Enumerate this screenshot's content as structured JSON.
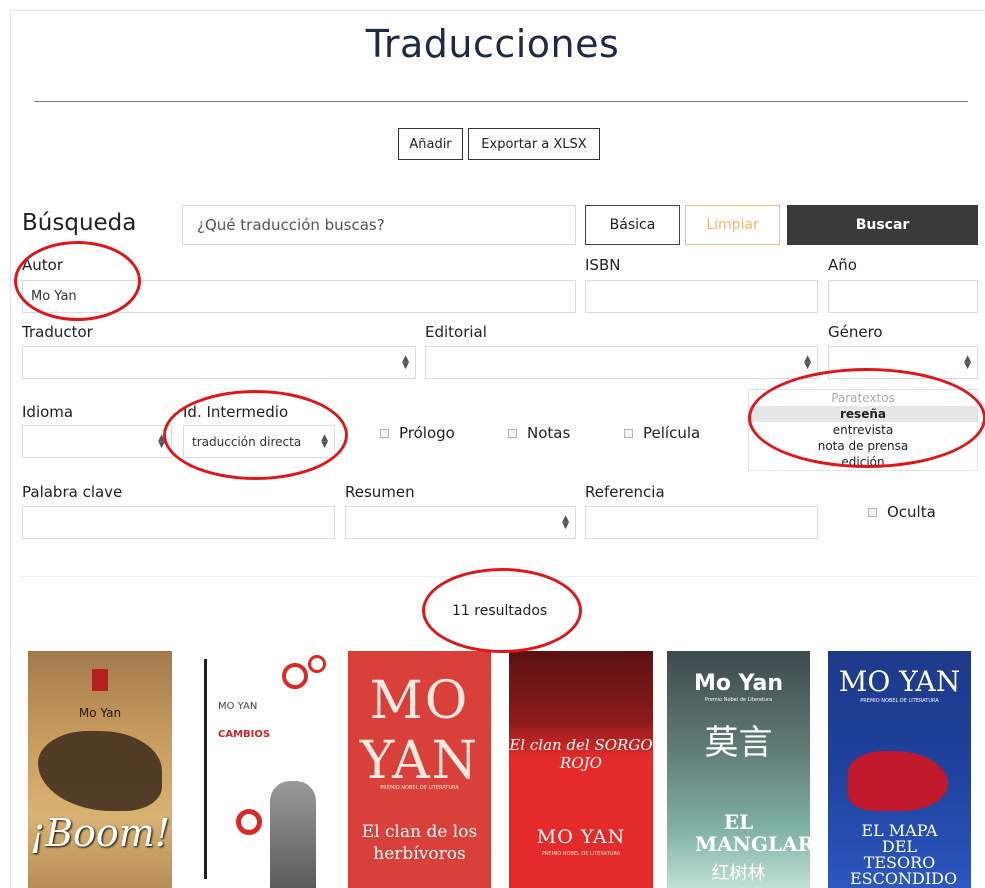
{
  "header": {
    "title": "Traducciones"
  },
  "toolbar": {
    "add_label": "Añadir",
    "export_label": "Exportar a XLSX"
  },
  "search": {
    "heading": "Búsqueda",
    "placeholder": "¿Qué traducción buscas?",
    "basic_label": "Básica",
    "clear_label": "Limpiar",
    "search_label": "Buscar"
  },
  "filters": {
    "autor_label": "Autor",
    "autor_value": "Mo Yan",
    "isbn_label": "ISBN",
    "anio_label": "Año",
    "traductor_label": "Traductor",
    "editorial_label": "Editorial",
    "genero_label": "Género",
    "idioma_label": "Idioma",
    "intermedio_label": "Id. Intermedio",
    "intermedio_value": "traducción directa",
    "prologo_label": "Prólogo",
    "notas_label": "Notas",
    "pelicula_label": "Película",
    "paratextos": {
      "placeholder": "Paratextos",
      "options": [
        "reseña",
        "entrevista",
        "nota de prensa",
        "edición"
      ],
      "selected": "reseña"
    },
    "palabra_label": "Palabra clave",
    "resumen_label": "Resumen",
    "referencia_label": "Referencia",
    "oculta_label": "Oculta"
  },
  "results": {
    "count_text": "11 resultados",
    "covers": [
      {
        "author": "Mo Yan",
        "title": "¡Boom!"
      },
      {
        "author": "MO YAN",
        "title": "CAMBIOS"
      },
      {
        "author": "MO YAN",
        "title": "El clan de los herbívoros",
        "subtitle": "PREMIO NOBEL DE LITERATURA"
      },
      {
        "author": "MO YAN",
        "title": "El clan del SORGO ROJO",
        "subtitle": "PREMIO NOBEL DE LITERATURA"
      },
      {
        "author": "Mo Yan",
        "chinese": "莫言",
        "title": "EL MANGLAR",
        "chinese_title": "红树林",
        "subtitle": "Premio Nobel de Literatura"
      },
      {
        "author": "MO YAN",
        "title": "EL MAPA DEL TESORO ESCONDIDO",
        "subtitle": "PREMIO NOBEL DE LITERATURA"
      }
    ]
  },
  "colors": {
    "accent_dark": "#3a3a3a",
    "clear_border": "#f1c27a",
    "annotation_red": "#e0161b",
    "title_color": "#1e2a44"
  }
}
